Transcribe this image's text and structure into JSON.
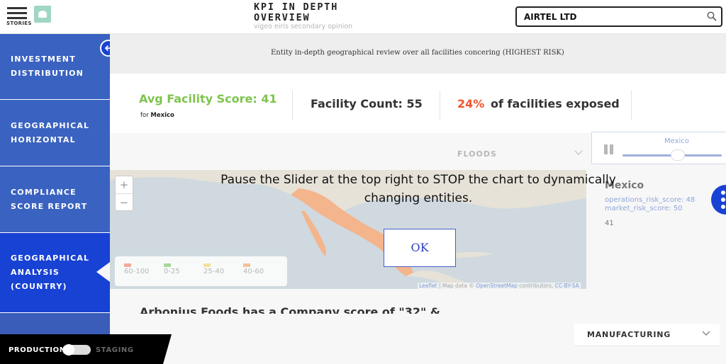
{
  "header": {
    "menu_label": "STORIES",
    "title_line1": "KPI IN DEPTH",
    "title_line2": "OVERVIEW",
    "subtitle": "vigeo eiris secondary opinion",
    "search_value": "AIRTEL LTD"
  },
  "sidebar": {
    "items": [
      {
        "line1": "INVESTMENT",
        "line2": "DISTRIBUTION"
      },
      {
        "line1": "GEOGRAPHICAL",
        "line2": "HORIZONTAL"
      },
      {
        "line1": "COMPLIANCE",
        "line2": "SCORE REPORT"
      },
      {
        "line1": "GEOGRAPHICAL",
        "line2": "ANALYSIS",
        "line3": "(COUNTRY)"
      }
    ]
  },
  "entity_banner": "Entity in-depth geographical review over all facilities concering (HIGHEST RISK)",
  "kpi": {
    "avg_label": "Avg Facility Score: 41",
    "for_prefix": "for",
    "for_country": "Mexico",
    "count_label": "Facility Count: 55",
    "pct": "24%",
    "pct_suffix": "of facilities exposed"
  },
  "filters": {
    "hazard": "FLOODS",
    "slider_country": "Mexico",
    "slider_position": 0.5,
    "sector": "MANUFACTURING"
  },
  "map": {
    "legend": [
      {
        "label": "60-100",
        "color": "#f4a99a"
      },
      {
        "label": "0-25",
        "color": "#a9d89a"
      },
      {
        "label": "25-40",
        "color": "#f5df9a"
      },
      {
        "label": "40-60",
        "color": "#f7c09a"
      }
    ],
    "attribution_leaflet": "Leaflet",
    "attribution_text": "| Map data ©",
    "attribution_osm": "OpenStreetMap",
    "attribution_contrib": "contributors,",
    "attribution_license": "CC-BY-SA"
  },
  "info_card": {
    "country": "Mexico",
    "line1": "operations_risk_score: 48",
    "line2": "market_risk_score: 50",
    "value": "41"
  },
  "dialog": {
    "message": "Pause the Slider at the top right to STOP the chart to dynamically changing entities.",
    "ok_label": "OK"
  },
  "company_text": "Arbonius Foods has a Company score of \"32\" &",
  "env": {
    "production": "PRODUCTION",
    "staging": "STAGING"
  },
  "colors": {
    "sidebar": "#3a62c0",
    "sidebar_active": "#1842d4",
    "score_green": "#7ec44e",
    "exposure_orange": "#f0552e"
  }
}
